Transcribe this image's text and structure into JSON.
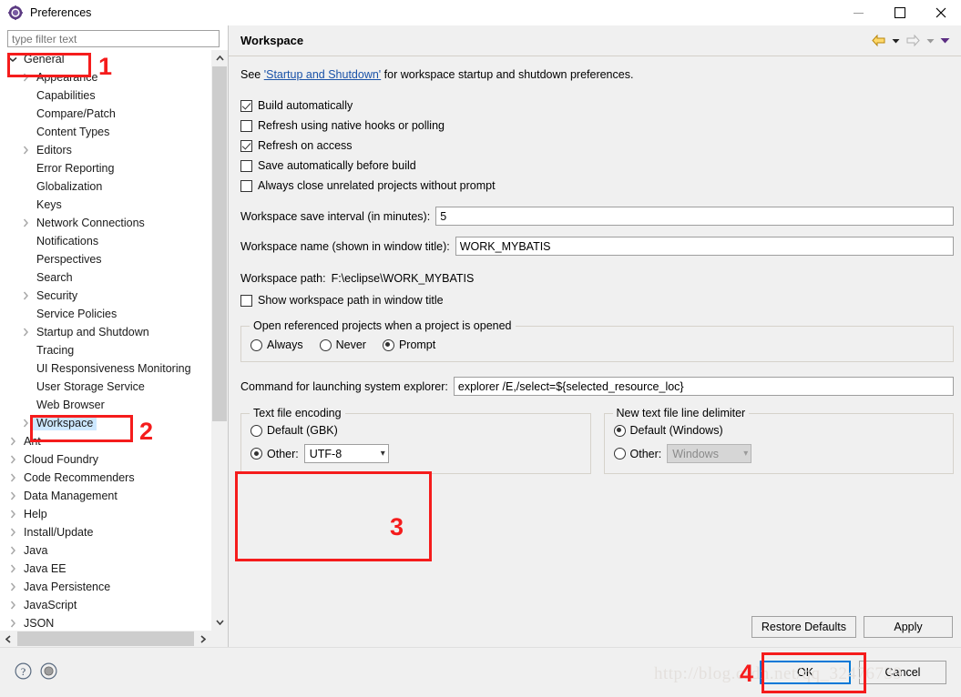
{
  "window": {
    "title": "Preferences",
    "icon": "preferences-gear-icon",
    "minimize": "minimize",
    "maximize": "maximize",
    "close": "close"
  },
  "sidebar": {
    "filter_placeholder": "type filter text",
    "filter_value": "",
    "items": [
      {
        "label": "General",
        "level": 1,
        "arrow": "down",
        "selected": false
      },
      {
        "label": "Appearance",
        "level": 2,
        "arrow": "right",
        "selected": false
      },
      {
        "label": "Capabilities",
        "level": 2,
        "arrow": "none",
        "selected": false
      },
      {
        "label": "Compare/Patch",
        "level": 2,
        "arrow": "none",
        "selected": false
      },
      {
        "label": "Content Types",
        "level": 2,
        "arrow": "none",
        "selected": false
      },
      {
        "label": "Editors",
        "level": 2,
        "arrow": "right",
        "selected": false
      },
      {
        "label": "Error Reporting",
        "level": 2,
        "arrow": "none",
        "selected": false
      },
      {
        "label": "Globalization",
        "level": 2,
        "arrow": "none",
        "selected": false
      },
      {
        "label": "Keys",
        "level": 2,
        "arrow": "none",
        "selected": false
      },
      {
        "label": "Network Connections",
        "level": 2,
        "arrow": "right",
        "selected": false
      },
      {
        "label": "Notifications",
        "level": 2,
        "arrow": "none",
        "selected": false
      },
      {
        "label": "Perspectives",
        "level": 2,
        "arrow": "none",
        "selected": false
      },
      {
        "label": "Search",
        "level": 2,
        "arrow": "none",
        "selected": false
      },
      {
        "label": "Security",
        "level": 2,
        "arrow": "right",
        "selected": false
      },
      {
        "label": "Service Policies",
        "level": 2,
        "arrow": "none",
        "selected": false
      },
      {
        "label": "Startup and Shutdown",
        "level": 2,
        "arrow": "right",
        "selected": false
      },
      {
        "label": "Tracing",
        "level": 2,
        "arrow": "none",
        "selected": false
      },
      {
        "label": "UI Responsiveness Monitoring",
        "level": 2,
        "arrow": "none",
        "selected": false
      },
      {
        "label": "User Storage Service",
        "level": 2,
        "arrow": "none",
        "selected": false
      },
      {
        "label": "Web Browser",
        "level": 2,
        "arrow": "none",
        "selected": false
      },
      {
        "label": "Workspace",
        "level": 2,
        "arrow": "right",
        "selected": true
      },
      {
        "label": "Ant",
        "level": 1,
        "arrow": "right",
        "selected": false
      },
      {
        "label": "Cloud Foundry",
        "level": 1,
        "arrow": "right",
        "selected": false
      },
      {
        "label": "Code Recommenders",
        "level": 1,
        "arrow": "right",
        "selected": false
      },
      {
        "label": "Data Management",
        "level": 1,
        "arrow": "right",
        "selected": false
      },
      {
        "label": "Help",
        "level": 1,
        "arrow": "right",
        "selected": false
      },
      {
        "label": "Install/Update",
        "level": 1,
        "arrow": "right",
        "selected": false
      },
      {
        "label": "Java",
        "level": 1,
        "arrow": "right",
        "selected": false
      },
      {
        "label": "Java EE",
        "level": 1,
        "arrow": "right",
        "selected": false
      },
      {
        "label": "Java Persistence",
        "level": 1,
        "arrow": "right",
        "selected": false
      },
      {
        "label": "JavaScript",
        "level": 1,
        "arrow": "right",
        "selected": false
      },
      {
        "label": "JSON",
        "level": 1,
        "arrow": "right",
        "selected": false
      }
    ]
  },
  "page": {
    "title": "Workspace",
    "nav": {
      "back": "back-arrow-icon",
      "back_menu": "back-dropdown-icon",
      "forward": "forward-arrow-icon",
      "forward_menu": "forward-dropdown-icon",
      "menu": "view-menu-icon"
    },
    "description_prefix": "See ",
    "description_link": "'Startup and Shutdown'",
    "description_suffix": " for workspace startup and shutdown preferences.",
    "checkboxes": [
      {
        "label": "Build automatically",
        "checked": true
      },
      {
        "label": "Refresh using native hooks or polling",
        "checked": false
      },
      {
        "label": "Refresh on access",
        "checked": true
      },
      {
        "label": "Save automatically before build",
        "checked": false
      },
      {
        "label": "Always close unrelated projects without prompt",
        "checked": false
      }
    ],
    "save_interval": {
      "label": "Workspace save interval (in minutes):",
      "value": "5"
    },
    "workspace_name": {
      "label": "Workspace name (shown in window title):",
      "value": "WORK_MYBATIS"
    },
    "workspace_path": {
      "label": "Workspace path:",
      "value": "F:\\eclipse\\WORK_MYBATIS"
    },
    "show_path_checkbox": {
      "label": "Show workspace path in window title",
      "checked": false
    },
    "referenced_projects": {
      "title": "Open referenced projects when a project is opened",
      "options": [
        {
          "label": "Always",
          "selected": false
        },
        {
          "label": "Never",
          "selected": false
        },
        {
          "label": "Prompt",
          "selected": true
        }
      ]
    },
    "explorer_command": {
      "label": "Command for launching system explorer:",
      "value": "explorer /E,/select=${selected_resource_loc}"
    },
    "text_file_encoding": {
      "title": "Text file encoding",
      "default_option": {
        "label": "Default (GBK)",
        "selected": false
      },
      "other_option": {
        "label": "Other:",
        "selected": true
      },
      "other_value": "UTF-8"
    },
    "line_delimiter": {
      "title": "New text file line delimiter",
      "default_option": {
        "label": "Default (Windows)",
        "selected": true
      },
      "other_option": {
        "label": "Other:",
        "selected": false
      },
      "other_value": "Windows",
      "other_disabled": true
    },
    "restore_defaults_label": "Restore Defaults",
    "apply_label": "Apply"
  },
  "footer": {
    "help_icon": "help-question-icon",
    "extra_icon": "filter-circle-icon",
    "ok_label": "OK",
    "cancel_label": "Cancel"
  },
  "annotations": {
    "numbers": [
      "1",
      "2",
      "3",
      "4"
    ],
    "color": "#f51c1c"
  },
  "watermark": "http://blog.csdn.net/qq_32476739"
}
